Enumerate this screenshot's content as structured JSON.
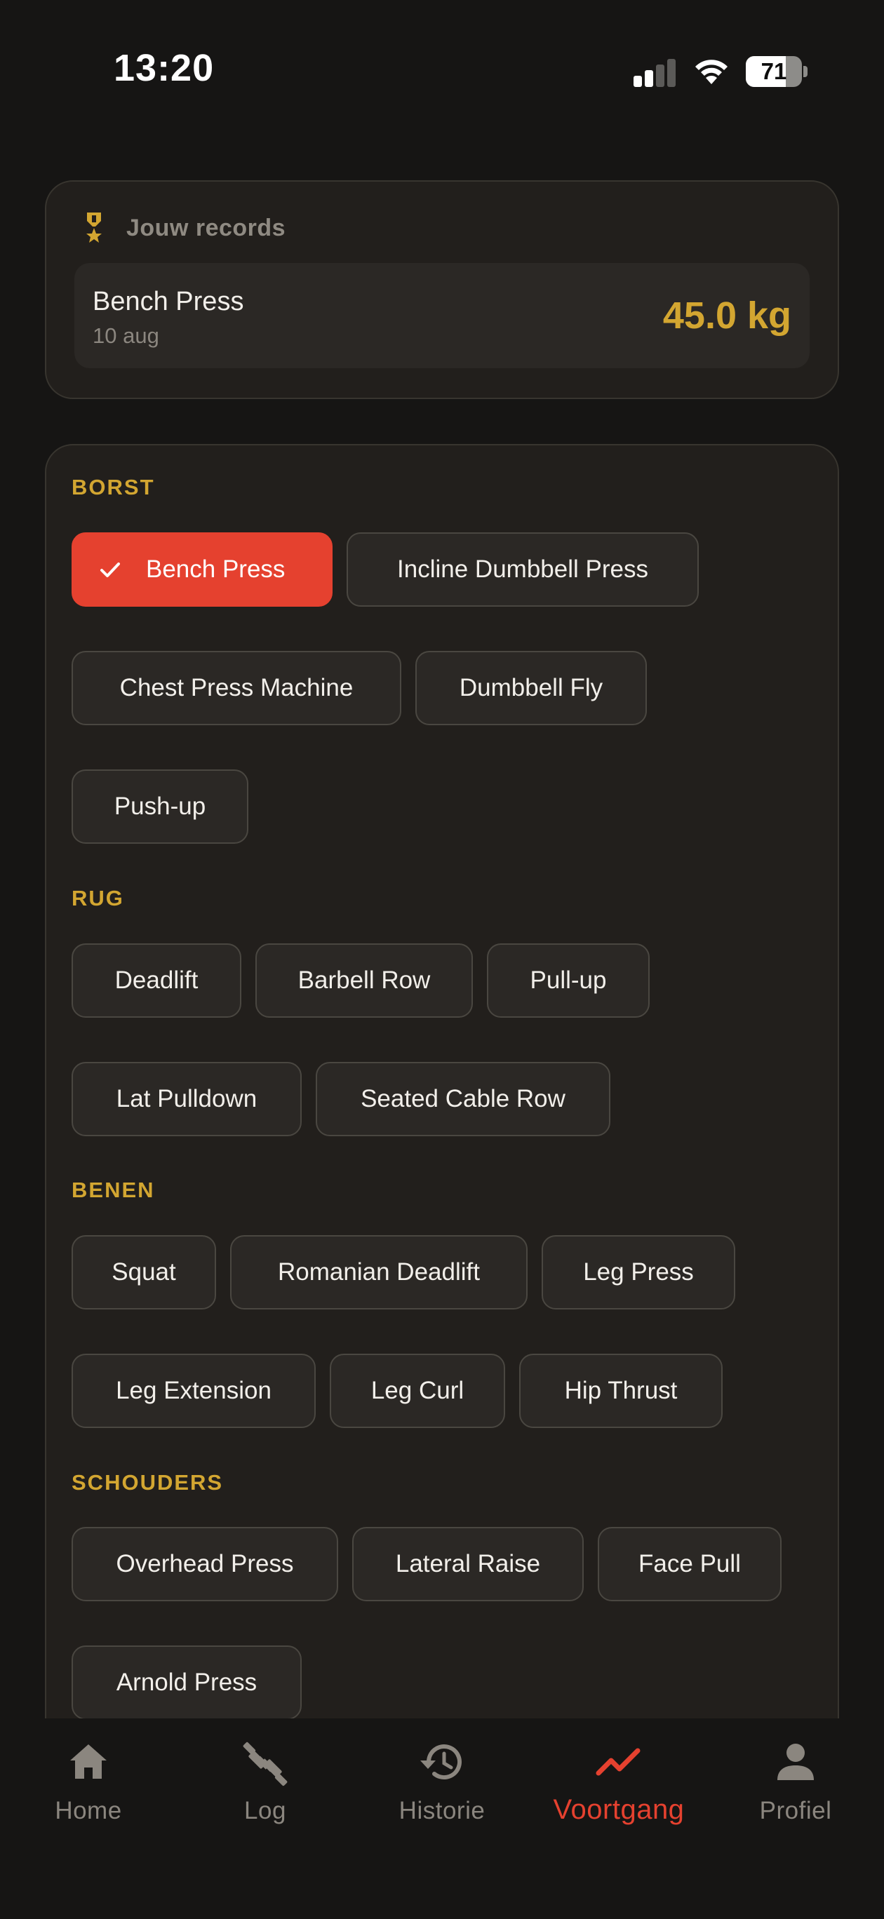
{
  "status_bar": {
    "time": "13:20",
    "battery_level": "71",
    "signal_bars": 2
  },
  "records": {
    "title": "Jouw records",
    "icon": "medal-icon",
    "items": [
      {
        "name": "Bench Press",
        "date": "10 aug",
        "value": "45.0 kg"
      }
    ]
  },
  "exercise_groups": [
    {
      "label": "BORST",
      "exercises": [
        "Bench Press",
        "Incline Dumbbell Press",
        "Chest Press Machine",
        "Dumbbell Fly",
        "Push-up"
      ]
    },
    {
      "label": "RUG",
      "exercises": [
        "Deadlift",
        "Barbell Row",
        "Pull-up",
        "Lat Pulldown",
        "Seated Cable Row"
      ]
    },
    {
      "label": "BENEN",
      "exercises": [
        "Squat",
        "Romanian Deadlift",
        "Leg Press",
        "Leg Extension",
        "Leg Curl",
        "Hip Thrust"
      ]
    },
    {
      "label": "SCHOUDERS",
      "exercises": [
        "Overhead Press",
        "Lateral Raise",
        "Face Pull",
        "Arnold Press"
      ]
    }
  ],
  "selected_exercise": "Bench Press",
  "nav": {
    "items": [
      {
        "label": "Home",
        "icon": "home-icon"
      },
      {
        "label": "Log",
        "icon": "dumbbell-icon"
      },
      {
        "label": "Historie",
        "icon": "history-icon"
      },
      {
        "label": "Voortgang",
        "icon": "trend-icon"
      },
      {
        "label": "Profiel",
        "icon": "profile-icon"
      }
    ],
    "active": "Voortgang"
  },
  "colors": {
    "background": "#161514",
    "card": "#221f1c",
    "accent_red": "#e5412f",
    "accent_gold": "#d3a631",
    "muted_text": "#8b867f"
  }
}
